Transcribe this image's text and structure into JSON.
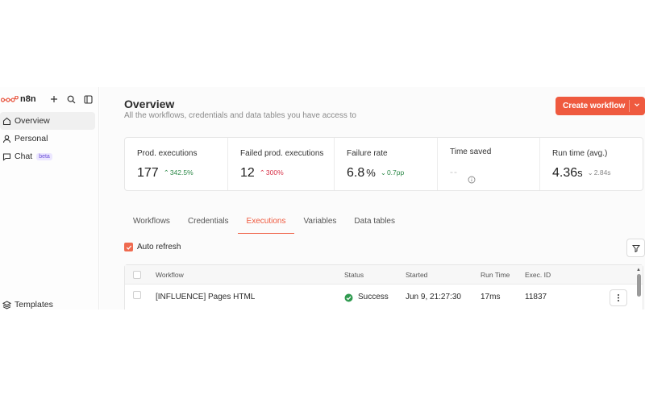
{
  "brand": {
    "name": "n8n"
  },
  "sidebar": {
    "items": [
      {
        "label": "Overview",
        "icon": "home-icon",
        "active": true
      },
      {
        "label": "Personal",
        "icon": "user-icon"
      },
      {
        "label": "Chat",
        "icon": "chat-icon",
        "badge": "beta"
      }
    ],
    "bottom": {
      "label": "Templates",
      "icon": "templates-icon"
    }
  },
  "header": {
    "title": "Overview",
    "subtitle": "All the workflows, credentials and data tables you have access to",
    "create_label": "Create workflow"
  },
  "stats": [
    {
      "label": "Prod. executions",
      "value": "177",
      "unit": "",
      "delta": "342.5%",
      "trend": "up",
      "color": "#2f8a4a"
    },
    {
      "label": "Failed prod. executions",
      "value": "12",
      "unit": "",
      "delta": "300%",
      "trend": "up",
      "color": "#d8344a"
    },
    {
      "label": "Failure rate",
      "value": "6.8",
      "unit": "%",
      "delta": "0.7pp",
      "trend": "down",
      "color": "#2f8a4a"
    },
    {
      "label": "Time saved",
      "value": "--",
      "unit": "",
      "delta": "",
      "trend": "none"
    },
    {
      "label": "Run time (avg.)",
      "value": "4.36",
      "unit": "s",
      "delta": "2.84s",
      "trend": "down",
      "color": "#888888"
    }
  ],
  "tabs": [
    {
      "label": "Workflows"
    },
    {
      "label": "Credentials"
    },
    {
      "label": "Executions",
      "active": true
    },
    {
      "label": "Variables"
    },
    {
      "label": "Data tables"
    }
  ],
  "auto_refresh": {
    "label": "Auto refresh",
    "checked": true
  },
  "table": {
    "columns": [
      "Workflow",
      "Status",
      "Started",
      "Run Time",
      "Exec. ID"
    ],
    "rows": [
      {
        "workflow": "[INFLUENCE] Pages HTML",
        "status": "Success",
        "started": "Jun 9, 21:27:30",
        "run_time": "17ms",
        "exec_id": "11837"
      }
    ]
  },
  "colors": {
    "accent": "#ef5a3f",
    "success": "#2f8a4a",
    "danger": "#d8344a"
  }
}
